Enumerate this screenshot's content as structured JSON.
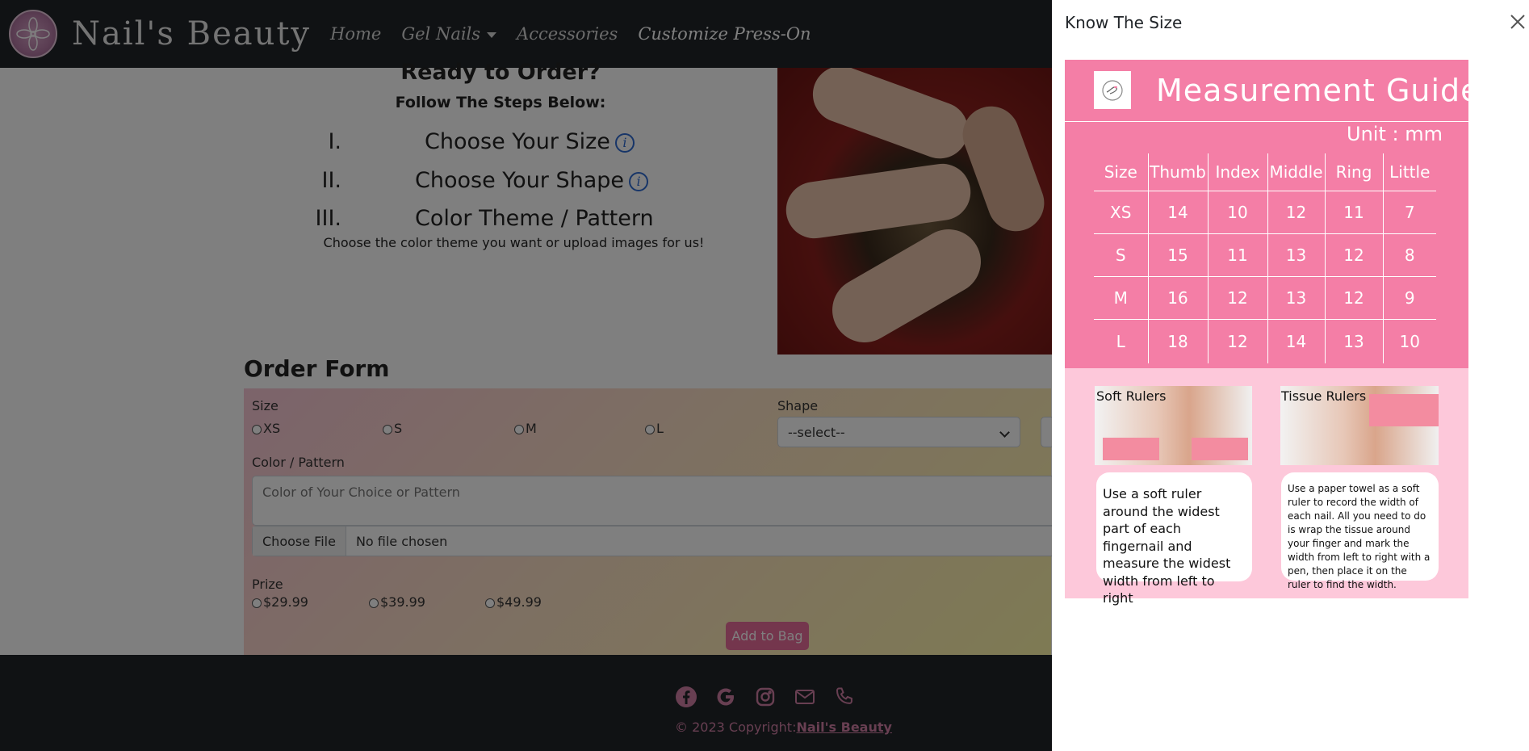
{
  "navbar": {
    "brand": "Nail's Beauty",
    "links": [
      "Home",
      "Gel Nails",
      "Accessories",
      "Customize Press-On"
    ]
  },
  "intro": {
    "title": "Ready to Order?",
    "subtitle": "Follow The Steps Below:",
    "steps": [
      {
        "num": "I.",
        "label": "Choose Your Size"
      },
      {
        "num": "II.",
        "label": "Choose Your Shape"
      },
      {
        "num": "III.",
        "label": "Color Theme / Pattern"
      }
    ],
    "note": "Choose the color theme you want or upload images for us!"
  },
  "order_form": {
    "title": "Order Form",
    "size_label": "Size",
    "sizes": [
      "XS",
      "S",
      "M",
      "L"
    ],
    "shape_label": "Shape",
    "shape_selected": "--select--",
    "color_label": "Color / Pattern",
    "color_placeholder": "Color of Your Choice or Pattern",
    "file_button": "Choose File",
    "file_status": "No file chosen",
    "price_label": "Prize",
    "prices": [
      "$29.99",
      "$39.99",
      "$49.99"
    ],
    "add_button": "Add to Bag"
  },
  "footer": {
    "copyright_prefix": "© 2023 Copyright:",
    "copyright_link": "Nail's Beauty",
    "icons": [
      "facebook-icon",
      "google-icon",
      "instagram-icon",
      "mail-icon",
      "phone-icon"
    ]
  },
  "offcanvas": {
    "title": "Know The Size",
    "guide": {
      "title": "Measurement Guide",
      "unit": "Unit : mm",
      "table": {
        "headers": [
          "Size",
          "Thumb",
          "Index",
          "Middle",
          "Ring",
          "Little"
        ],
        "rows": [
          [
            "XS",
            "14",
            "10",
            "12",
            "11",
            "7"
          ],
          [
            "S",
            "15",
            "11",
            "13",
            "12",
            "8"
          ],
          [
            "M",
            "16",
            "12",
            "13",
            "12",
            "9"
          ],
          [
            "L",
            "18",
            "12",
            "14",
            "13",
            "10"
          ]
        ]
      },
      "soft_ruler": {
        "label": "Soft Rulers",
        "text": "Use a soft ruler around the widest part of each fingernail and measure the widest width from left to right"
      },
      "tissue_ruler": {
        "label": "Tissue Rulers",
        "text": "Use a paper towel as a soft ruler to record the width of each nail. All you need to do is wrap the tissue around your finger and mark the width from left to right with a pen, then place it on the ruler to find the width."
      }
    }
  },
  "colors": {
    "navbar": "#212529",
    "guide_pink": "#f47ea6",
    "guide_light_pink": "#fdc8da",
    "accent": "#e86c9a",
    "info_blue": "#2e6ad1"
  }
}
